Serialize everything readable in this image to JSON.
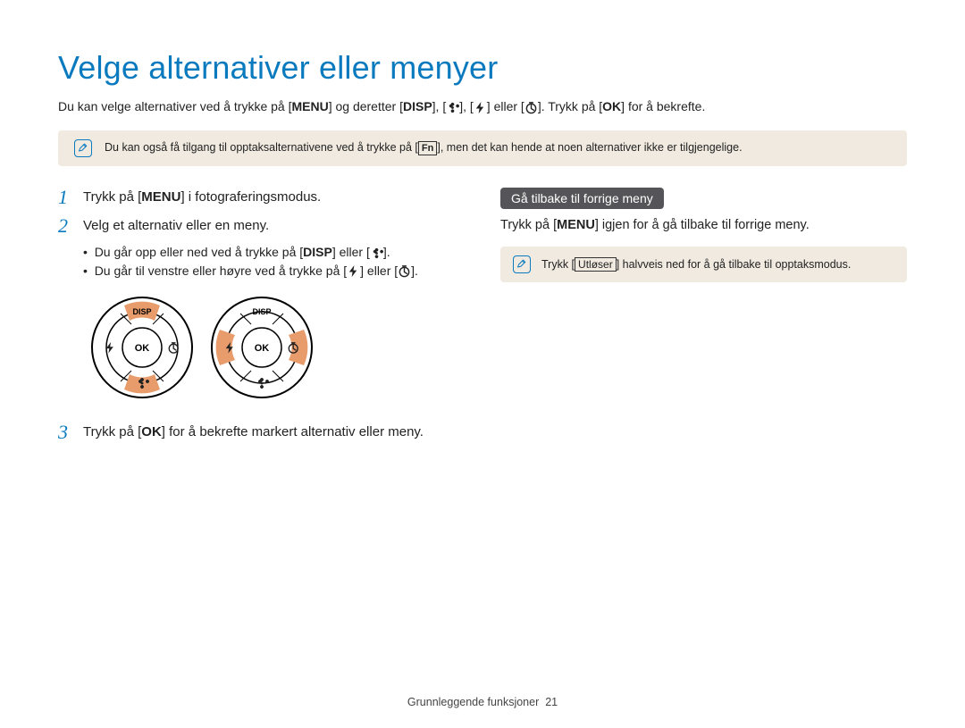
{
  "title": "Velge alternativer eller menyer",
  "intro": {
    "part1": "Du kan velge alternativer ved å trykke på [",
    "menu": "MENU",
    "part2": "] og deretter [",
    "disp": "DISP",
    "part3": "], [",
    "part4": "], [",
    "part5": "] eller [",
    "part6": "]. Trykk på [",
    "ok": "OK",
    "part7": "] for å bekrefte."
  },
  "topnote": {
    "pre": "Du kan også få tilgang til opptaksalternativene ved å trykke på [",
    "fn": "Fn",
    "post": "], men det kan hende at noen alternativer ikke er tilgjengelige."
  },
  "steps": {
    "s1": {
      "num": "1",
      "pre": "Trykk på [",
      "menu": "MENU",
      "post": "] i fotograferingsmodus."
    },
    "s2": {
      "num": "2",
      "text": "Velg et alternativ eller en meny.",
      "b1": {
        "pre": "Du går opp eller ned ved å trykke på [",
        "disp": "DISP",
        "mid": "] eller [",
        "post": "]."
      },
      "b2": {
        "pre": "Du går til venstre eller høyre ved å trykke på [",
        "mid": "] eller [",
        "post": "]."
      }
    },
    "s3": {
      "num": "3",
      "pre": "Trykk på [",
      "ok": "OK",
      "post": "] for å bekrefte markert alternativ eller meny."
    }
  },
  "right": {
    "heading": "Gå tilbake til forrige meny",
    "pre": "Trykk på [",
    "menu": "MENU",
    "post": "] igjen for å gå tilbake til forrige meny.",
    "note": {
      "pre": "Trykk [",
      "btn": "Utløser",
      "post": "] halvveis ned for å gå tilbake til opptaksmodus."
    }
  },
  "dial": {
    "disp": "DISP",
    "ok": "OK"
  },
  "footer": {
    "section": "Grunnleggende funksjoner",
    "page": "21"
  }
}
